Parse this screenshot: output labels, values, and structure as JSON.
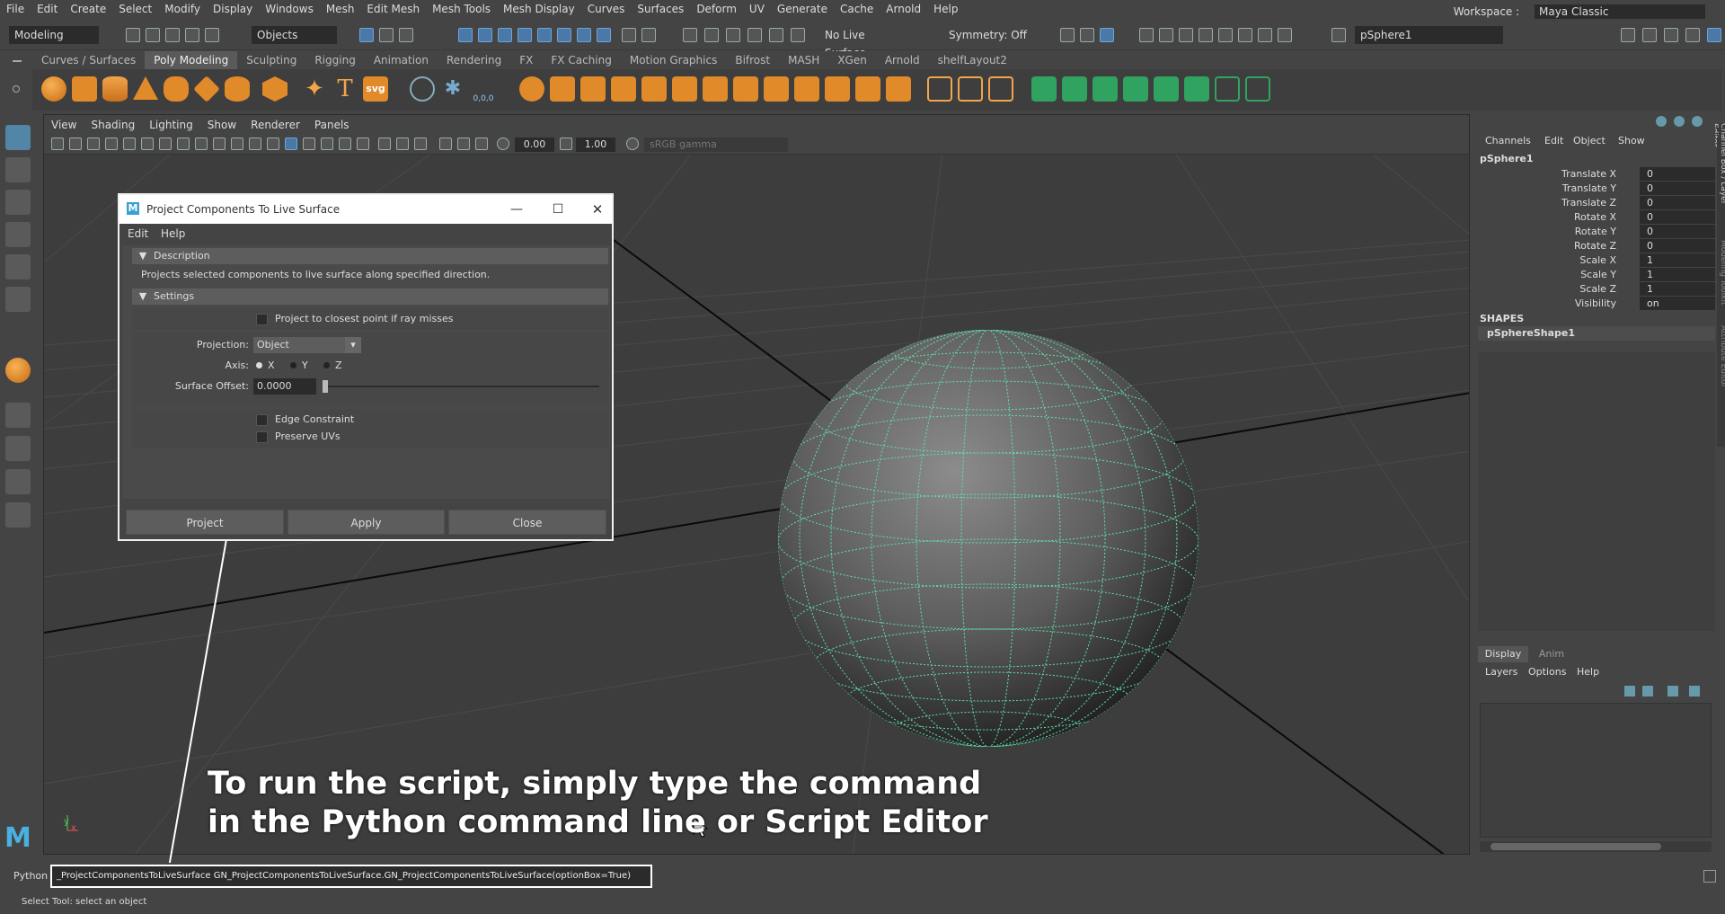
{
  "menubar": {
    "items": [
      "File",
      "Edit",
      "Create",
      "Select",
      "Modify",
      "Display",
      "Windows",
      "Mesh",
      "Edit Mesh",
      "Mesh Tools",
      "Mesh Display",
      "Curves",
      "Surfaces",
      "Deform",
      "UV",
      "Generate",
      "Cache",
      "Arnold",
      "Help"
    ],
    "workspace_label": "Workspace :",
    "workspace_value": "Maya Classic"
  },
  "statusline": {
    "mode": "Modeling",
    "selection_mask": "Objects",
    "live_surface": "No Live Surface",
    "symmetry": "Symmetry: Off",
    "name_field": "pSphere1"
  },
  "shelf": {
    "tabs": [
      "Curves / Surfaces",
      "Poly Modeling",
      "Sculpting",
      "Rigging",
      "Animation",
      "Rendering",
      "FX",
      "FX Caching",
      "Motion Graphics",
      "Bifrost",
      "MASH",
      "XGen",
      "Arnold",
      "shelfLayout2"
    ],
    "active_tab": "Poly Modeling",
    "svg_label": "svg",
    "text_tool": "T",
    "coords_label": "0,0,0"
  },
  "viewport": {
    "menus": [
      "View",
      "Shading",
      "Lighting",
      "Show",
      "Renderer",
      "Panels"
    ],
    "exposure": "0.00",
    "gamma": "1.00",
    "colorspace": "sRGB gamma",
    "axis_y": "y",
    "axis_x": "x"
  },
  "dialog": {
    "title": "Project Components To Live Surface",
    "menus": [
      "Edit",
      "Help"
    ],
    "section_description": "Description",
    "description_text": "Projects selected components to live surface along specified direction.",
    "section_settings": "Settings",
    "closest_point_label": "Project to closest point if ray misses",
    "projection_label": "Projection:",
    "projection_value": "Object",
    "axis_label": "Axis:",
    "axis_options": [
      "X",
      "Y",
      "Z"
    ],
    "surface_offset_label": "Surface Offset:",
    "surface_offset_value": "0.0000",
    "edge_constraint_label": "Edge Constraint",
    "preserve_uvs_label": "Preserve UVs",
    "buttons": {
      "project": "Project",
      "apply": "Apply",
      "close": "Close"
    }
  },
  "channel_box": {
    "menus": [
      "Channels",
      "Edit",
      "Object",
      "Show"
    ],
    "object": "pSphere1",
    "attributes": [
      {
        "label": "Translate X",
        "value": "0"
      },
      {
        "label": "Translate Y",
        "value": "0"
      },
      {
        "label": "Translate Z",
        "value": "0"
      },
      {
        "label": "Rotate X",
        "value": "0"
      },
      {
        "label": "Rotate Y",
        "value": "0"
      },
      {
        "label": "Rotate Z",
        "value": "0"
      },
      {
        "label": "Scale X",
        "value": "1"
      },
      {
        "label": "Scale Y",
        "value": "1"
      },
      {
        "label": "Scale Z",
        "value": "1"
      },
      {
        "label": "Visibility",
        "value": "on"
      }
    ],
    "shapes_header": "SHAPES",
    "shape_name": "pSphereShape1",
    "side_tabs": [
      "Channel Box / Layer Editor",
      "Modeling Toolkit",
      "Attribute Editor"
    ]
  },
  "layer_editor": {
    "tabs": [
      "Display",
      "Anim"
    ],
    "menus": [
      "Layers",
      "Options",
      "Help"
    ]
  },
  "overlay": {
    "line1": "To run the script, simply type the command",
    "line2": "in the Python command line or Script Editor"
  },
  "command_line": {
    "label": "Python",
    "value": "_ProjectComponentsToLiveSurface GN_ProjectComponentsToLiveSurface.GN_ProjectComponentsToLiveSurface(optionBox=True)"
  },
  "help_line": {
    "text": "Select Tool: select an object"
  },
  "logo": "M"
}
